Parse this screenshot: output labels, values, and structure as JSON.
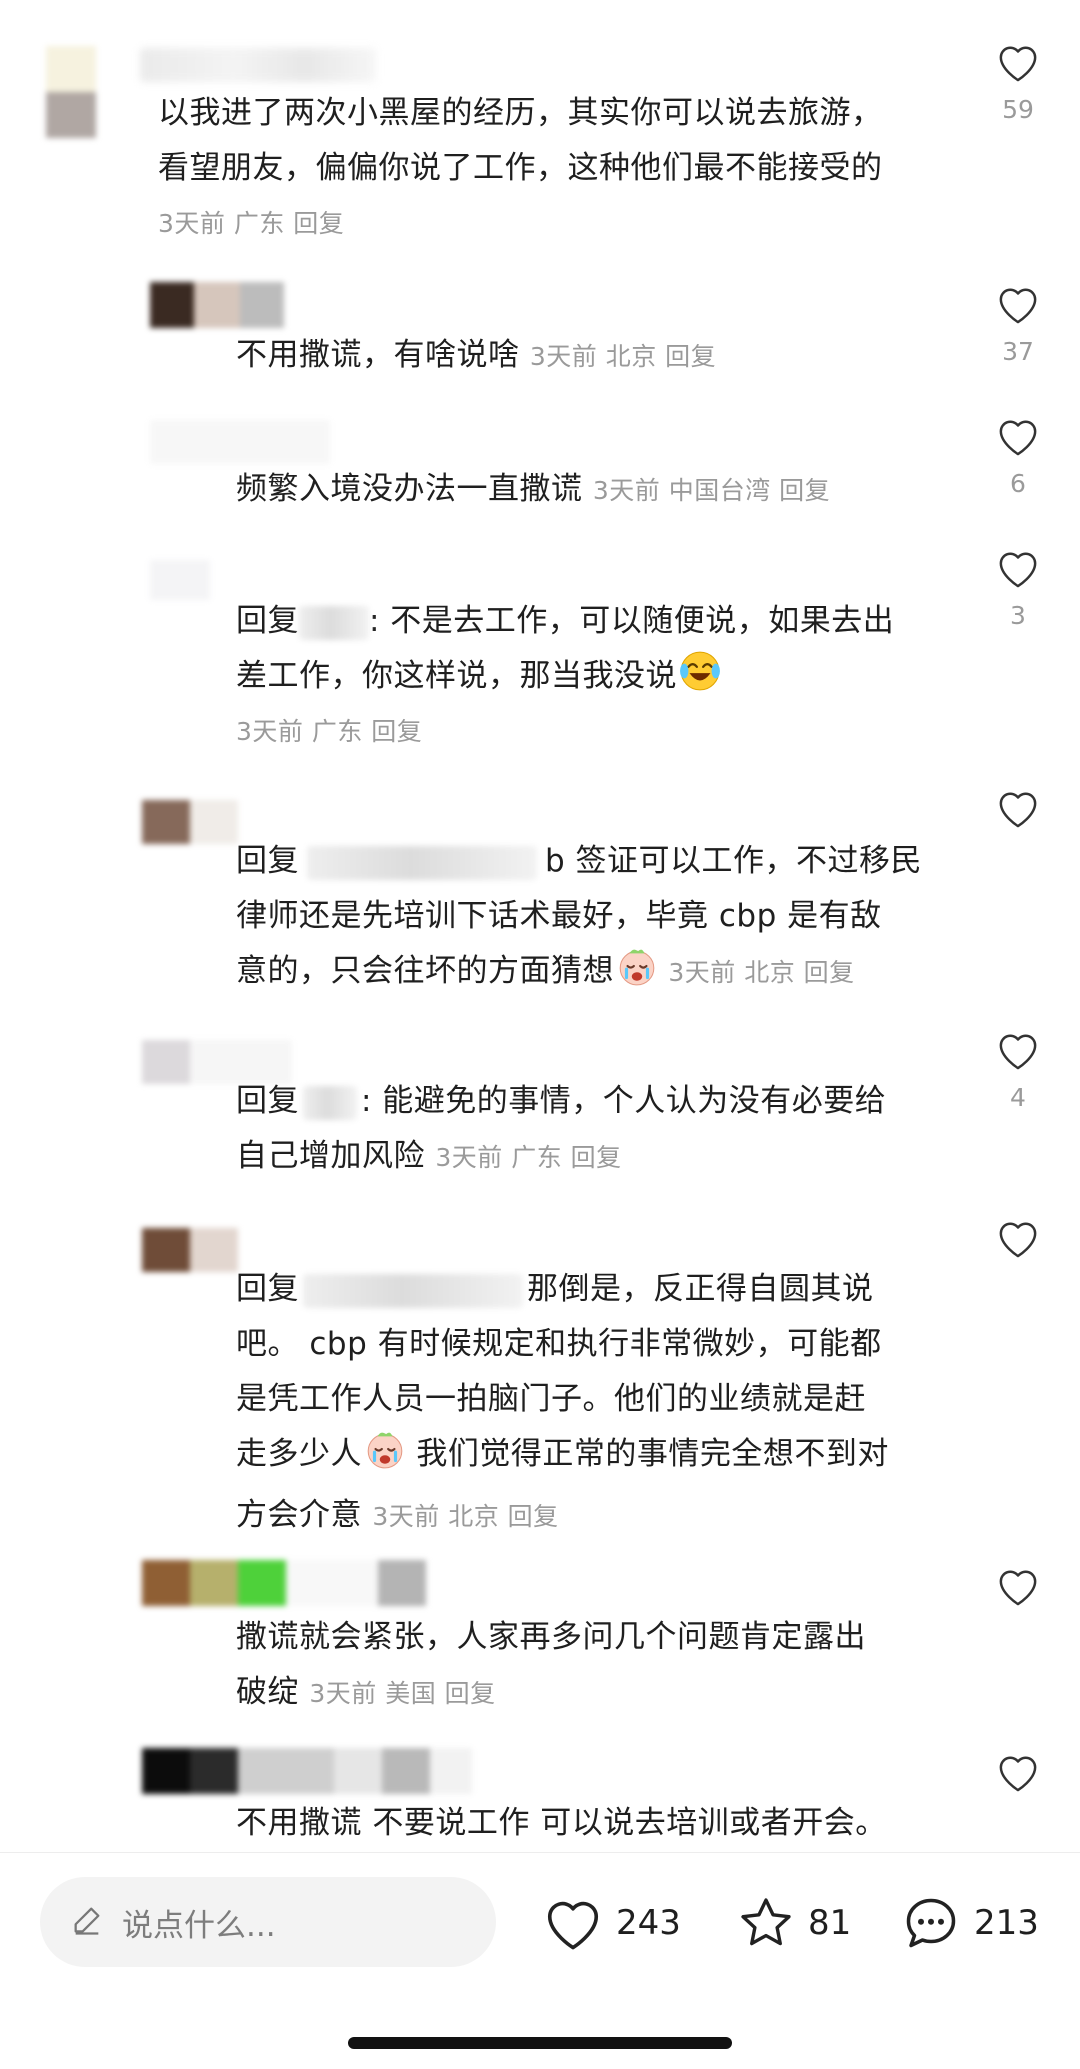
{
  "comments": [
    {
      "lines": [
        "以我进了两次小黑屋的经历，其实你可以说去旅游，",
        "看望朋友，偏偏你说了工作，这种他们最不能接受的"
      ],
      "meta": "3天前 广东 回复",
      "likes": "59"
    },
    {
      "text": "不用撒谎，有啥说啥",
      "meta": "3天前 北京 回复",
      "likes": "37"
    },
    {
      "text": "频繁入境没办法一直撒谎",
      "meta": "3天前 中国台湾 回复",
      "likes": "6"
    },
    {
      "prefix": "回复",
      "line1": ": 不是去工作，可以随便说，如果去出",
      "line2": "差工作，你这样说，那当我没说",
      "meta": "3天前 广东 回复",
      "likes": "3",
      "emoji": "laughing-tears-emoji"
    },
    {
      "prefix": "回复",
      "line1": "b 签证可以工作，不过移民",
      "line2": "律师还是先培训下话术最好，毕竟 cbp 是有敌",
      "line3": "意的，只会往坏的方面猜想",
      "meta": "3天前 北京 回复",
      "likes": "",
      "emoji": "crying-face-emoji"
    },
    {
      "prefix": "回复",
      "line1": ": 能避免的事情，个人认为没有必要给",
      "line2": "自己增加风险",
      "meta": "3天前 广东 回复",
      "likes": "4"
    },
    {
      "prefix": "回复",
      "line1": "那倒是，反正得自圆其说",
      "line2": "吧。 cbp 有时候规定和执行非常微妙，可能都",
      "line3": "是凭工作人员一拍脑门子。他们的业绩就是赶",
      "line4a": "走多少人",
      "line4b": " 我们觉得正常的事情完全想不到对",
      "line5": "方会介意",
      "meta": "3天前 北京 回复",
      "likes": "",
      "emoji": "crying-face-emoji"
    },
    {
      "line1": "撒谎就会紧张，人家再多问几个问题肯定露出",
      "line2": "破绽",
      "meta": "3天前 美国 回复",
      "likes": ""
    },
    {
      "text": "不用撒谎 不要说工作 可以说去培训或者开会。",
      "likes": ""
    }
  ],
  "bottom": {
    "placeholder": "说点什么...",
    "likes": "243",
    "favorites": "81",
    "comments": "213"
  },
  "colors": {
    "text": "#1f1f1f",
    "meta": "#9a9a9a",
    "background": "#ffffff",
    "input_bg": "#f3f3f3"
  }
}
